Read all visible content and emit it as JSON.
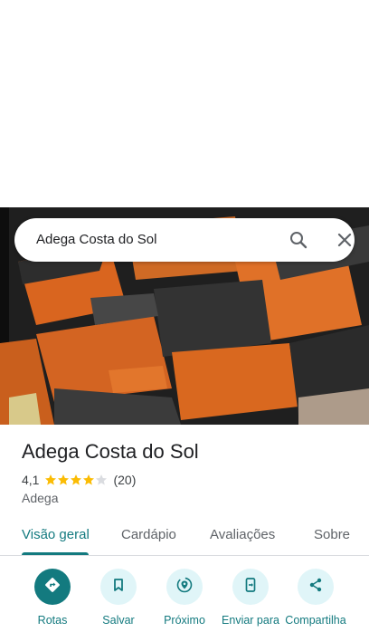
{
  "search": {
    "query": "Adega Costa do Sol"
  },
  "place": {
    "name": "Adega Costa do Sol",
    "rating": "4,1",
    "stars_filled": 4,
    "stars_total": 5,
    "reviews": "(20)",
    "category": "Adega"
  },
  "tabs": [
    {
      "label": "Visão geral",
      "active": true
    },
    {
      "label": "Cardápio",
      "active": false
    },
    {
      "label": "Avaliações",
      "active": false
    },
    {
      "label": "Sobre",
      "active": false
    }
  ],
  "actions": [
    {
      "label": "Rotas",
      "icon": "directions-icon"
    },
    {
      "label": "Salvar",
      "icon": "bookmark-icon"
    },
    {
      "label": "Próximo",
      "icon": "nearby-icon"
    },
    {
      "label": "Enviar para",
      "icon": "send-to-phone-icon"
    },
    {
      "label": "Compartilha",
      "icon": "share-icon"
    }
  ],
  "colors": {
    "accent": "#137a7f",
    "star": "#fbbc04",
    "action_bg": "#e0f5f8"
  }
}
